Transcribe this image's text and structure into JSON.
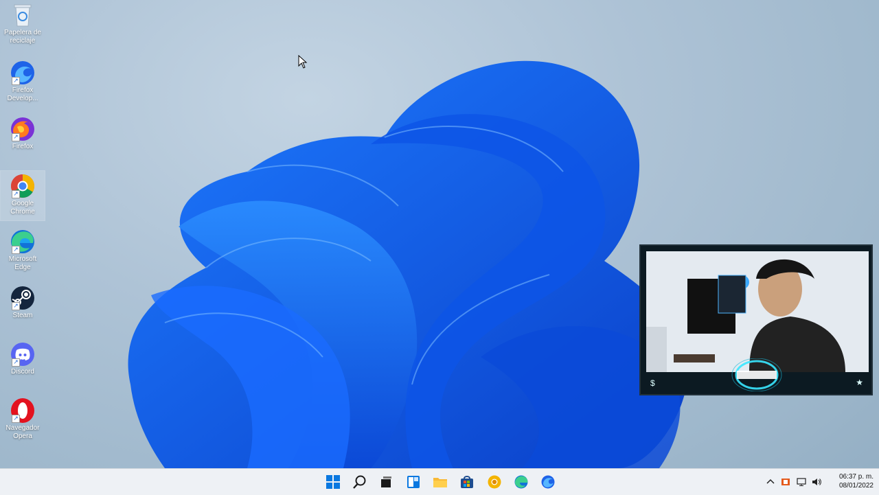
{
  "desktop": {
    "icons": [
      {
        "label": "Papelera de reciclaje",
        "icon": "recycle-bin-icon"
      },
      {
        "label": "Firefox Develop...",
        "icon": "firefox-developer-icon"
      },
      {
        "label": "Firefox",
        "icon": "firefox-icon"
      },
      {
        "label": "Google Chrome",
        "icon": "chrome-icon"
      },
      {
        "label": "Microsoft Edge",
        "icon": "edge-icon"
      },
      {
        "label": "Steam",
        "icon": "steam-icon"
      },
      {
        "label": "Discord",
        "icon": "discord-icon"
      },
      {
        "label": "Navegador Opera",
        "icon": "opera-icon"
      }
    ],
    "selected_icon": "Google Chrome"
  },
  "webcam": {
    "left_text": "$",
    "right_text": "★"
  },
  "taskbar": {
    "apps": [
      "start-icon",
      "search-icon",
      "task-view-icon",
      "widgets-icon",
      "file-explorer-icon",
      "store-icon",
      "chrome-icon",
      "edge-icon",
      "firefox-icon"
    ],
    "tray": [
      "chevron-up-icon",
      "app-tray-icon",
      "monitor-icon",
      "volume-icon"
    ],
    "time": "06:37 p. m.",
    "date": "08/01/2022"
  },
  "colors": {
    "accent": "#0a5ce0",
    "taskbar": "#eef1f5",
    "wallpaper": "#a9c0d4"
  }
}
